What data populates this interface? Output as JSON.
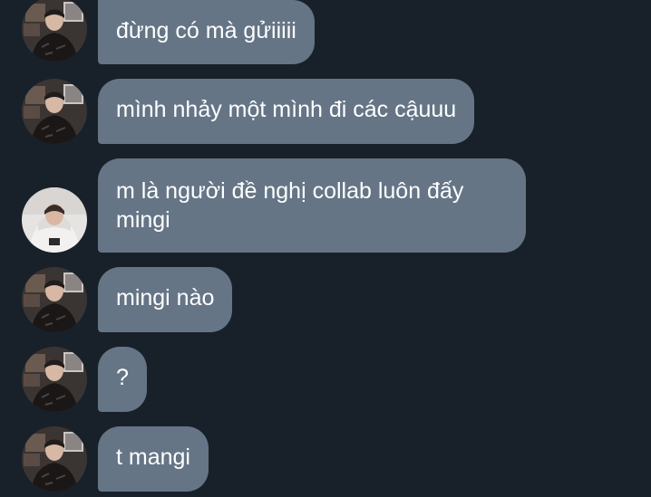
{
  "messages": [
    {
      "text": "đừng có mà gửiiiii",
      "avatar": "boy-dark-jacket"
    },
    {
      "text": "mình nhảy một mình đi các cậuuu",
      "avatar": "boy-dark-jacket"
    },
    {
      "text": "m là người đề nghị collab luôn đấy mingi",
      "avatar": "boy-white-hoodie"
    },
    {
      "text": "mingi nào",
      "avatar": "boy-dark-jacket"
    },
    {
      "text": "?",
      "avatar": "boy-dark-jacket"
    },
    {
      "text": "t mangi",
      "avatar": "boy-dark-jacket"
    }
  ],
  "colors": {
    "background": "#18212a",
    "bubble": "#657586",
    "text": "#ffffff"
  }
}
